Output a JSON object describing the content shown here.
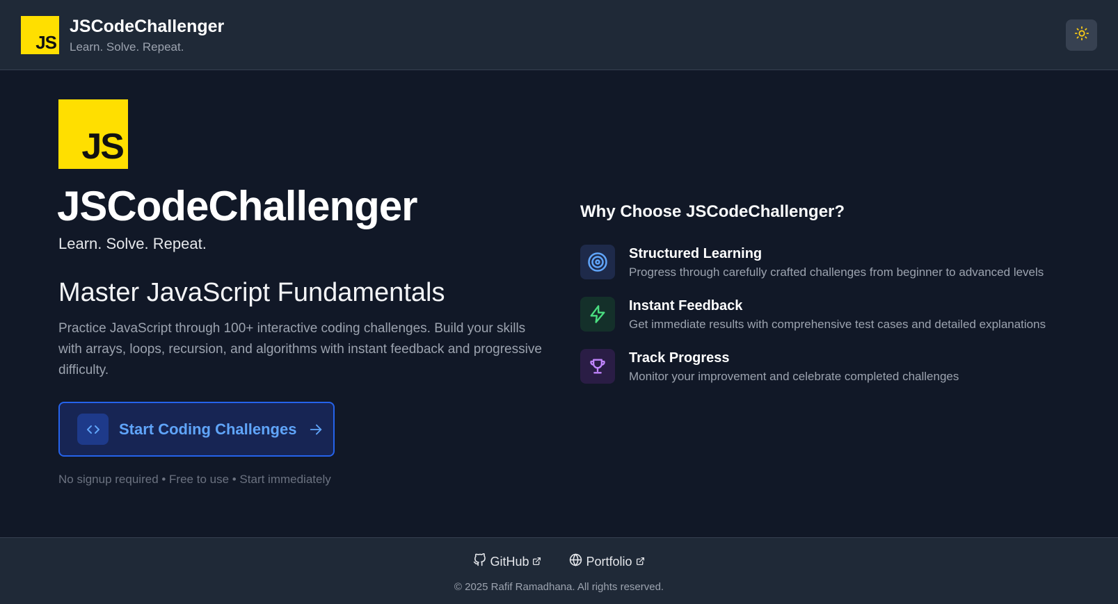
{
  "header": {
    "logo_text": "JS",
    "title": "JSCodeChallenger",
    "tagline": "Learn. Solve. Repeat.",
    "theme_toggle_icon": "sun-icon"
  },
  "hero": {
    "logo_text": "JS",
    "title": "JSCodeChallenger",
    "tagline": "Learn. Solve. Repeat.",
    "heading": "Master JavaScript Fundamentals",
    "description": "Practice JavaScript through 100+ interactive coding challenges. Build your skills with arrays, loops, recursion, and algorithms with instant feedback and progressive difficulty.",
    "cta_label": "Start Coding Challenges",
    "cta_icon": "code-icon",
    "note": "No signup required • Free to use • Start immediately"
  },
  "features": {
    "heading": "Why Choose JSCodeChallenger?",
    "items": [
      {
        "icon": "target-icon",
        "title": "Structured Learning",
        "description": "Progress through carefully crafted challenges from beginner to advanced levels",
        "color": "#60a5fa"
      },
      {
        "icon": "lightning-icon",
        "title": "Instant Feedback",
        "description": "Get immediate results with comprehensive test cases and detailed explanations",
        "color": "#4ade80"
      },
      {
        "icon": "trophy-icon",
        "title": "Track Progress",
        "description": "Monitor your improvement and celebrate completed challenges",
        "color": "#c084fc"
      }
    ]
  },
  "footer": {
    "links": [
      {
        "label": "GitHub",
        "icon": "github-icon"
      },
      {
        "label": "Portfolio",
        "icon": "globe-icon"
      }
    ],
    "copyright": "© 2025 Rafif Ramadhana. All rights reserved."
  },
  "colors": {
    "background": "#111827",
    "header_bg": "#1f2937",
    "js_yellow": "#ffdf00",
    "accent_blue": "#60a5fa"
  }
}
